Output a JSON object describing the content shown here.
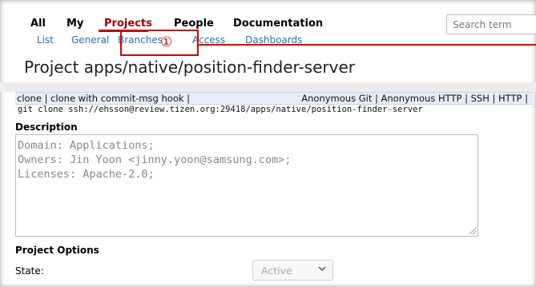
{
  "topnav": {
    "all": "All",
    "my": "My",
    "projects": "Projects",
    "people": "People",
    "documentation": "Documentation"
  },
  "search": {
    "placeholder": "Search term"
  },
  "subnav": {
    "list": "List",
    "general": "General",
    "branches": "Branches",
    "access": "Access",
    "dashboards": "Dashboards"
  },
  "annotation": {
    "marker": "①"
  },
  "page": {
    "title": "Project apps/native/position-finder-server"
  },
  "clonebar": {
    "left": "clone | clone with commit-msg hook |",
    "right": "Anonymous Git | Anonymous HTTP | SSH | HTTP |"
  },
  "clone_command": "git clone ssh://ehsson@review.tizen.org:29418/apps/native/position-finder-server",
  "description": {
    "label": "Description",
    "lines": [
      "Domain: Applications;",
      "Owners: Jin Yoon <jinny.yoon@samsung.com>;",
      "Licenses: Apache-2.0;"
    ]
  },
  "options": {
    "label": "Project Options",
    "state_label": "State:",
    "state_value": "Active"
  },
  "colors": {
    "accent_red": "#d40000",
    "link_blue": "#2a6ebb"
  }
}
